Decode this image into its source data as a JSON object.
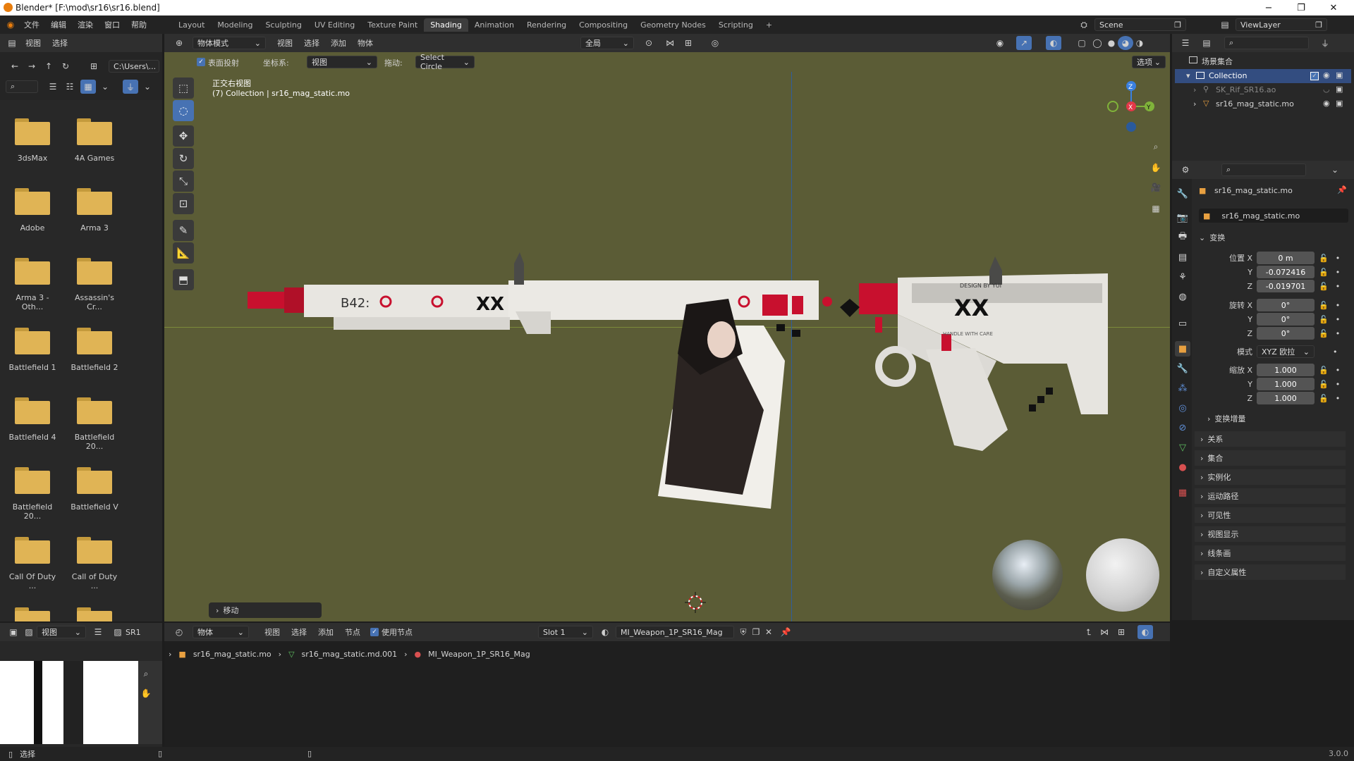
{
  "window": {
    "title": "Blender* [F:\\mod\\sr16\\sr16.blend]",
    "minimize": "−",
    "restore": "❐",
    "close": "✕"
  },
  "menubar": {
    "menus": [
      "文件",
      "编辑",
      "渲染",
      "窗口",
      "帮助"
    ],
    "workspaces": [
      "Layout",
      "Modeling",
      "Sculpting",
      "UV Editing",
      "Texture Paint",
      "Shading",
      "Animation",
      "Rendering",
      "Compositing",
      "Geometry Nodes",
      "Scripting"
    ],
    "active_workspace": "Shading",
    "add_tab": "+",
    "scene": "Scene",
    "view_layer": "ViewLayer"
  },
  "file_browser": {
    "header": [
      "视图",
      "选择"
    ],
    "path": "C:\\Users\\...",
    "folders": [
      "3dsMax",
      "4A Games",
      "Adobe",
      "Arma 3",
      "Arma 3 - Oth...",
      "Assassin's Cr...",
      "Battlefield 1",
      "Battlefield 2",
      "Battlefield 4",
      "Battlefield 20...",
      "Battlefield 20...",
      "Battlefield V",
      "Call Of Duty ...",
      "Call of Duty ..."
    ]
  },
  "viewport": {
    "header": {
      "mode": "物体模式",
      "menus": [
        "视图",
        "选择",
        "添加",
        "物体"
      ],
      "orientation": "全局"
    },
    "toolbar2": {
      "surface_project": "表面投射",
      "coord_label": "坐标系:",
      "coord_value": "视图",
      "drag_label": "拖动:",
      "drag_value": "Select Circle",
      "options": "选项"
    },
    "overlay_title": "正交右视图",
    "overlay_subtitle": "(7) Collection | sr16_mag_static.mo",
    "operator_panel": "移动",
    "gizmo": {
      "z": "Z",
      "y": "Y",
      "x": "X"
    }
  },
  "weapon_decals": {
    "b42": "B42:",
    "xx1": "XX",
    "xx2": "XX",
    "design": "DESIGN BY YUI",
    "handle": "HANDLE WITH CARE"
  },
  "outliner": {
    "scene_collection": "场景集合",
    "collection": "Collection",
    "items": [
      "SK_Rif_SR16.ao",
      "sr16_mag_static.mo"
    ]
  },
  "properties": {
    "object_name": "sr16_mag_static.mo",
    "object_field": "sr16_mag_static.mo",
    "transform_title": "变换",
    "location": {
      "label_x": "位置 X",
      "label_y": "Y",
      "label_z": "Z",
      "x": "0 m",
      "y": "-0.072416",
      "z": "-0.019701"
    },
    "rotation": {
      "label_x": "旋转 X",
      "label_y": "Y",
      "label_z": "Z",
      "x": "0°",
      "y": "0°",
      "z": "0°"
    },
    "mode": {
      "label": "模式",
      "value": "XYZ 欧拉"
    },
    "scale": {
      "label_x": "缩放 X",
      "label_y": "Y",
      "label_z": "Z",
      "x": "1.000",
      "y": "1.000",
      "z": "1.000"
    },
    "delta": "变换增量",
    "sections": [
      "关系",
      "集合",
      "实例化",
      "运动路径",
      "可见性",
      "视图显示",
      "线条画",
      "自定义属性"
    ]
  },
  "node_editor": {
    "header": {
      "mode": "物体",
      "menus": [
        "视图",
        "选择",
        "添加",
        "节点"
      ],
      "use_nodes": "使用节点",
      "slot": "Slot 1",
      "material": "MI_Weapon_1P_SR16_Mag"
    },
    "breadcrumb": [
      "sr16_mag_static.mo",
      "sr16_mag_static.md.001",
      "MI_Weapon_1P_SR16_Mag"
    ]
  },
  "image_editor": {
    "view": "视图",
    "name": "SR1"
  },
  "statusbar": {
    "select": "选择",
    "version": "3.0.0"
  }
}
